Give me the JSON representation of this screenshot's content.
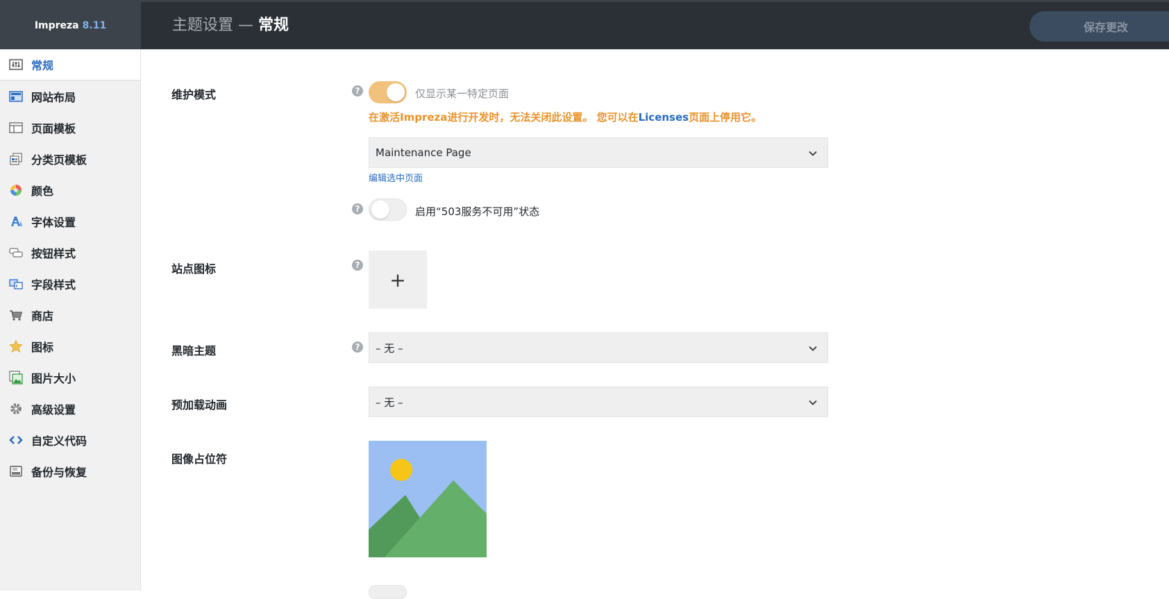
{
  "app": {
    "name": "Impreza",
    "version": "8.11"
  },
  "header": {
    "title_prefix": "主题设置 — ",
    "title_current": "常规",
    "save_label": "保存更改"
  },
  "sidebar": {
    "items": [
      {
        "label": "常规",
        "icon": "sliders-icon",
        "active": true
      },
      {
        "label": "网站布局",
        "icon": "layout-icon"
      },
      {
        "label": "页面模板",
        "icon": "page-template-icon"
      },
      {
        "label": "分类页模板",
        "icon": "archive-template-icon"
      },
      {
        "label": "颜色",
        "icon": "color-wheel-icon"
      },
      {
        "label": "字体设置",
        "icon": "typography-icon"
      },
      {
        "label": "按钮样式",
        "icon": "button-style-icon"
      },
      {
        "label": "字段样式",
        "icon": "field-style-icon"
      },
      {
        "label": "商店",
        "icon": "cart-icon"
      },
      {
        "label": "图标",
        "icon": "star-icon"
      },
      {
        "label": "图片大小",
        "icon": "image-size-icon"
      },
      {
        "label": "高级设置",
        "icon": "gear-icon"
      },
      {
        "label": "自定义代码",
        "icon": "code-icon"
      },
      {
        "label": "备份与恢复",
        "icon": "backup-icon"
      }
    ]
  },
  "main": {
    "maintenance": {
      "label": "维护模式",
      "toggle_label": "仅显示某一特定页面",
      "toggle_on": true,
      "warning_before": "在激活Impreza进行开发时，无法关闭此设置。 您可以在",
      "warning_link": "Licenses",
      "warning_after": "页面上停用它。",
      "page_select": "Maintenance Page",
      "edit_link": "编辑选中页面",
      "status_toggle_label": "启用“503服务不可用”状态",
      "status_toggle_on": false
    },
    "site_icon": {
      "label": "站点图标",
      "add": "+"
    },
    "dark_theme": {
      "label": "黑暗主题",
      "value": "– 无 –"
    },
    "preloader": {
      "label": "预加载动画",
      "value": "– 无 –"
    },
    "image_placeholder": {
      "label": "图像占位符"
    },
    "help_glyph": "?"
  },
  "colors": {
    "accent": "#2a6bbf",
    "warning": "#e8932a",
    "toggle_on": "#f1c27d",
    "header_bg": "#2b3036"
  }
}
